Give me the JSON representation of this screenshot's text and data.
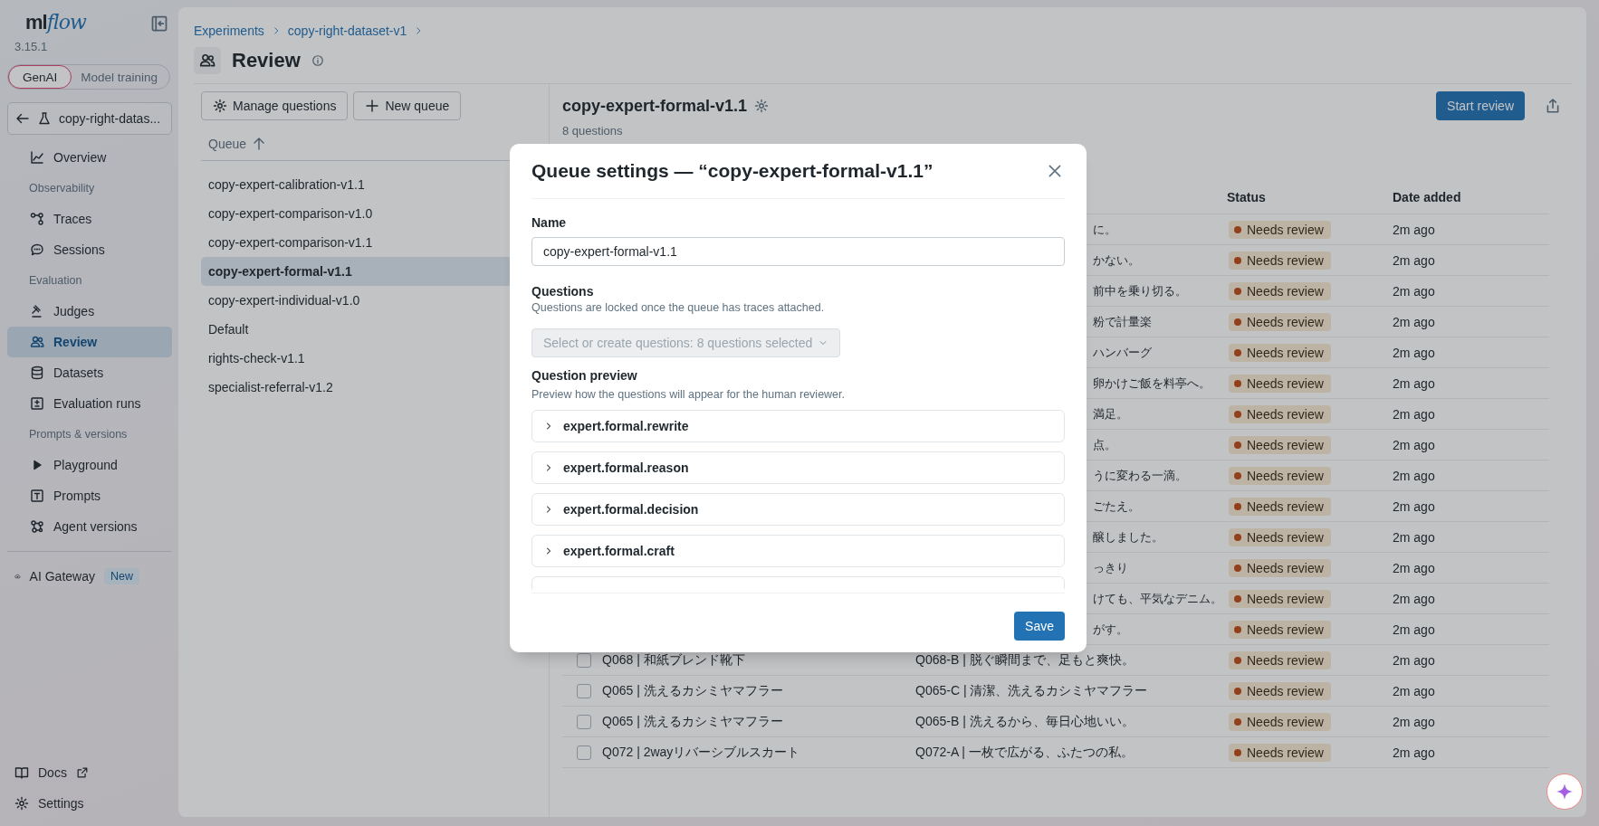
{
  "sidebar": {
    "logo": {
      "prefix": "ml",
      "suffix": "flow"
    },
    "version": "3.15.1",
    "modes": [
      {
        "label": "GenAI",
        "selected": true
      },
      {
        "label": "Model training",
        "selected": false
      }
    ],
    "experiment": "copy-right-datas...",
    "nav": [
      {
        "kind": "item",
        "label": "Overview",
        "selected": false
      },
      {
        "kind": "section",
        "label": "Observability"
      },
      {
        "kind": "item",
        "label": "Traces",
        "selected": false
      },
      {
        "kind": "item",
        "label": "Sessions",
        "selected": false
      },
      {
        "kind": "section",
        "label": "Evaluation"
      },
      {
        "kind": "item",
        "label": "Judges",
        "selected": false
      },
      {
        "kind": "item",
        "label": "Review",
        "selected": true
      },
      {
        "kind": "item",
        "label": "Datasets",
        "selected": false
      },
      {
        "kind": "item",
        "label": "Evaluation runs",
        "selected": false
      },
      {
        "kind": "section",
        "label": "Prompts & versions"
      },
      {
        "kind": "item",
        "label": "Playground",
        "selected": false
      },
      {
        "kind": "item",
        "label": "Prompts",
        "selected": false
      },
      {
        "kind": "item",
        "label": "Agent versions",
        "selected": false
      }
    ],
    "gateway": {
      "label": "AI Gateway",
      "badge": "New"
    },
    "footer": [
      {
        "label": "Docs"
      },
      {
        "label": "Settings"
      }
    ]
  },
  "breadcrumb": [
    "Experiments",
    "copy-right-dataset-v1"
  ],
  "page_title": "Review",
  "queue_panel": {
    "buttons": [
      "Manage questions",
      "New queue"
    ],
    "column": "Queue",
    "queues": [
      {
        "name": "copy-expert-calibration-v1.1",
        "selected": false
      },
      {
        "name": "copy-expert-comparison-v1.0",
        "selected": false
      },
      {
        "name": "copy-expert-comparison-v1.1",
        "selected": false
      },
      {
        "name": "copy-expert-formal-v1.1",
        "selected": true
      },
      {
        "name": "copy-expert-individual-v1.0",
        "selected": false
      },
      {
        "name": "Default",
        "selected": false
      },
      {
        "name": "rights-check-v1.1",
        "selected": false
      },
      {
        "name": "specialist-referral-v1.2",
        "selected": false
      }
    ]
  },
  "detail": {
    "title": "copy-expert-formal-v1.1",
    "count": "8 questions",
    "start_button": "Start review",
    "columns": [
      "Status",
      "Date added"
    ],
    "rows": [
      {
        "answer": "に。",
        "status": "Needs review",
        "date": "2m ago"
      },
      {
        "answer": "かない。",
        "status": "Needs review",
        "date": "2m ago"
      },
      {
        "answer": "前中を乗り切る。",
        "status": "Needs review",
        "date": "2m ago"
      },
      {
        "answer": "粉で計量楽",
        "status": "Needs review",
        "date": "2m ago"
      },
      {
        "answer": "ハンバーグ",
        "status": "Needs review",
        "date": "2m ago"
      },
      {
        "answer": "卵かけご飯を料亭へ。",
        "status": "Needs review",
        "date": "2m ago"
      },
      {
        "answer": "満足。",
        "status": "Needs review",
        "date": "2m ago"
      },
      {
        "answer": "点。",
        "status": "Needs review",
        "date": "2m ago"
      },
      {
        "answer": "うに変わる一滴。",
        "status": "Needs review",
        "date": "2m ago"
      },
      {
        "answer": "ごたえ。",
        "status": "Needs review",
        "date": "2m ago"
      },
      {
        "answer": "醸しました。",
        "status": "Needs review",
        "date": "2m ago"
      },
      {
        "answer": "っきり",
        "status": "Needs review",
        "date": "2m ago"
      },
      {
        "answer": "けても、平気なデニム。",
        "status": "Needs review",
        "date": "2m ago"
      },
      {
        "answer": "がす。",
        "status": "Needs review",
        "date": "2m ago"
      },
      {
        "question": "Q068 | 和紙ブレンド靴下",
        "checked": false,
        "answer": "Q068-B | 脱ぐ瞬間まで、足もと爽快。",
        "status": "Needs review",
        "date": "2m ago"
      },
      {
        "question": "Q065 | 洗えるカシミヤマフラー",
        "checked": false,
        "answer": "Q065-C | 清潔、洗えるカシミヤマフラー",
        "status": "Needs review",
        "date": "2m ago"
      },
      {
        "question": "Q065 | 洗えるカシミヤマフラー",
        "checked": false,
        "answer": "Q065-B | 洗えるから、毎日心地いい。",
        "status": "Needs review",
        "date": "2m ago"
      },
      {
        "question": "Q072 | 2wayリバーシブルスカート",
        "checked": false,
        "answer": "Q072-A | 一枚で広がる、ふたつの私。",
        "status": "Needs review",
        "date": "2m ago"
      }
    ]
  },
  "modal": {
    "title": "Queue settings — “copy-expert-formal-v1.1”",
    "name_label": "Name",
    "name_value": "copy-expert-formal-v1.1",
    "questions_label": "Questions",
    "questions_help": "Questions are locked once the queue has traces attached.",
    "select": {
      "placeholder": "Select or create questions: 8 questions selected",
      "disabled": true
    },
    "preview_label": "Question preview",
    "preview_help": "Preview how the questions will appear for the human reviewer.",
    "previews": [
      {
        "kind": "item",
        "label": "expert.formal.rewrite",
        "expanded": false
      },
      {
        "kind": "item",
        "label": "expert.formal.reason",
        "expanded": false
      },
      {
        "kind": "item",
        "label": "expert.formal.decision",
        "expanded": false
      },
      {
        "kind": "item",
        "label": "expert.formal.craft",
        "expanded": false
      },
      {
        "kind": "partial"
      }
    ],
    "save": "Save"
  }
}
